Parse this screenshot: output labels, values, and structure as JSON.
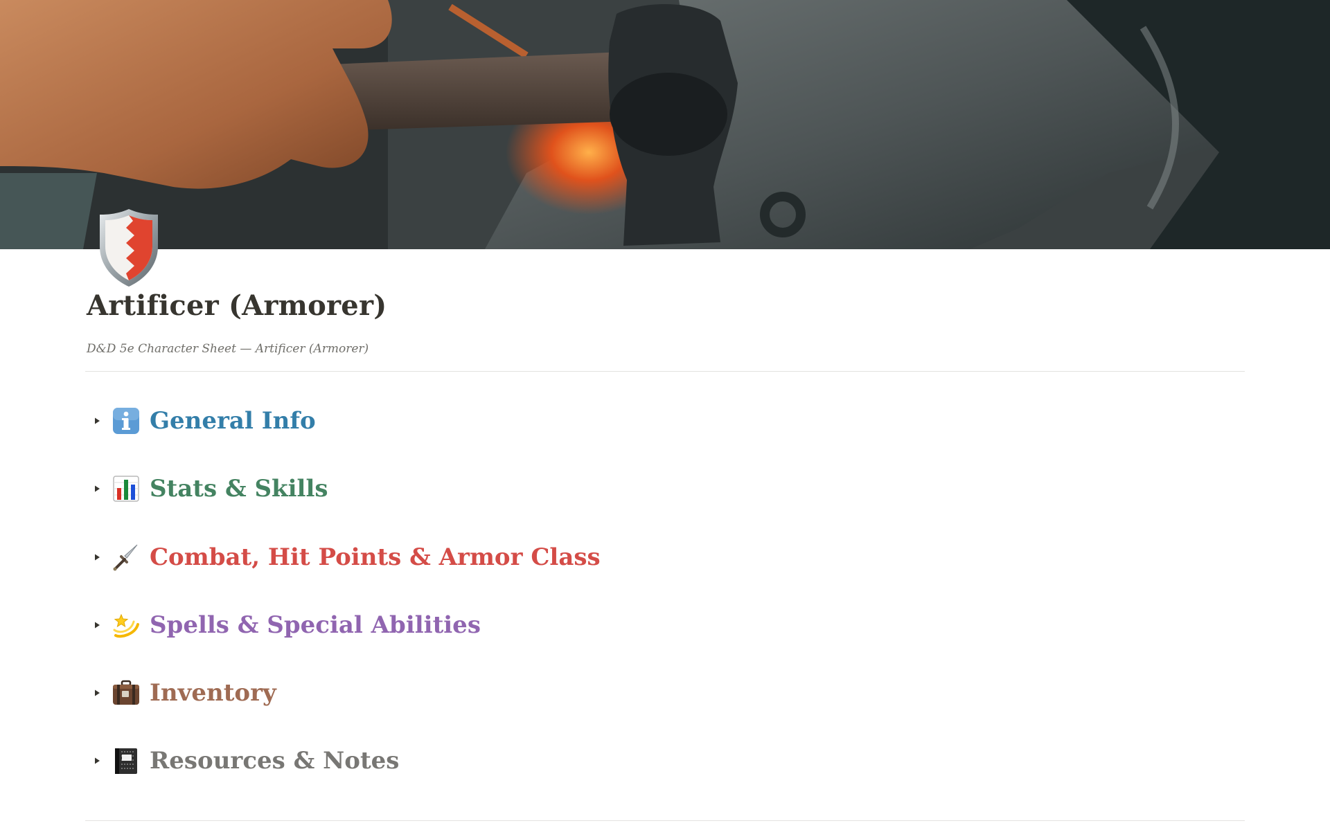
{
  "page": {
    "title": "Artificer (Armorer)",
    "subtitle": "D&D 5e  Character Sheet — Artificer (Armorer)"
  },
  "toggles": [
    {
      "label": "General Info",
      "icon": "information-icon",
      "color": "#337ea9"
    },
    {
      "label": "Stats & Skills",
      "icon": "bar-chart-icon",
      "color": "#448361"
    },
    {
      "label": "Combat, Hit Points & Armor Class",
      "icon": "dagger-icon",
      "color": "#d44c47"
    },
    {
      "label": "Spells & Special Abilities",
      "icon": "dizzy-star-icon",
      "color": "#9065b0"
    },
    {
      "label": "Inventory",
      "icon": "luggage-icon",
      "color": "#9f6b53"
    },
    {
      "label": "Resources & Notes",
      "icon": "notebook-icon",
      "color": "#787774"
    }
  ],
  "cover": {
    "icon": "forge-cover-image"
  },
  "page_icon": "shield-icon"
}
